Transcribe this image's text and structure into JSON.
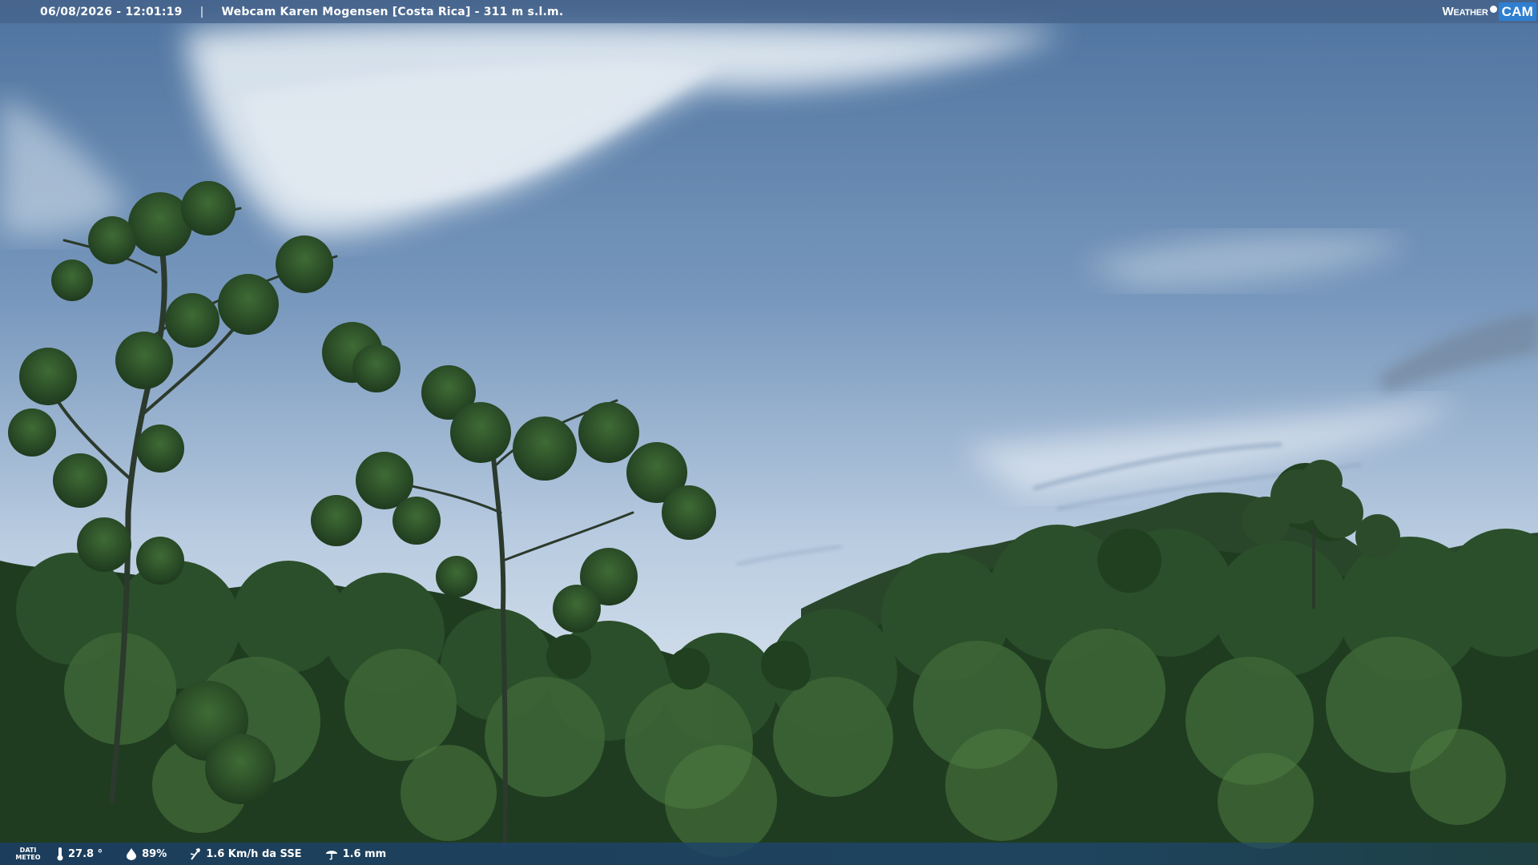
{
  "header": {
    "datetime": "06/08/2026 - 12:01:19",
    "separator": "|",
    "title": "Webcam Karen Mogensen [Costa Rica] - 311 m s.l.m."
  },
  "brand": {
    "left": "Weather",
    "right": "CAM",
    "accent_color": "#2f7fd0"
  },
  "footer": {
    "label_line1": "DATI",
    "label_line2": "METEO",
    "temperature": "27.8 °",
    "humidity": "89%",
    "wind": "1.6 Km/h da SSE",
    "rain": "1.6 mm",
    "icons": [
      "thermometer-icon",
      "humidity-drop-icon",
      "wind-icon",
      "rain-icon"
    ]
  },
  "colors": {
    "sky_top": "#5f82ad",
    "sky_bottom": "#c9d8e8",
    "foliage_dark": "#1c3a1e",
    "foliage_light": "#4d7a3a"
  }
}
